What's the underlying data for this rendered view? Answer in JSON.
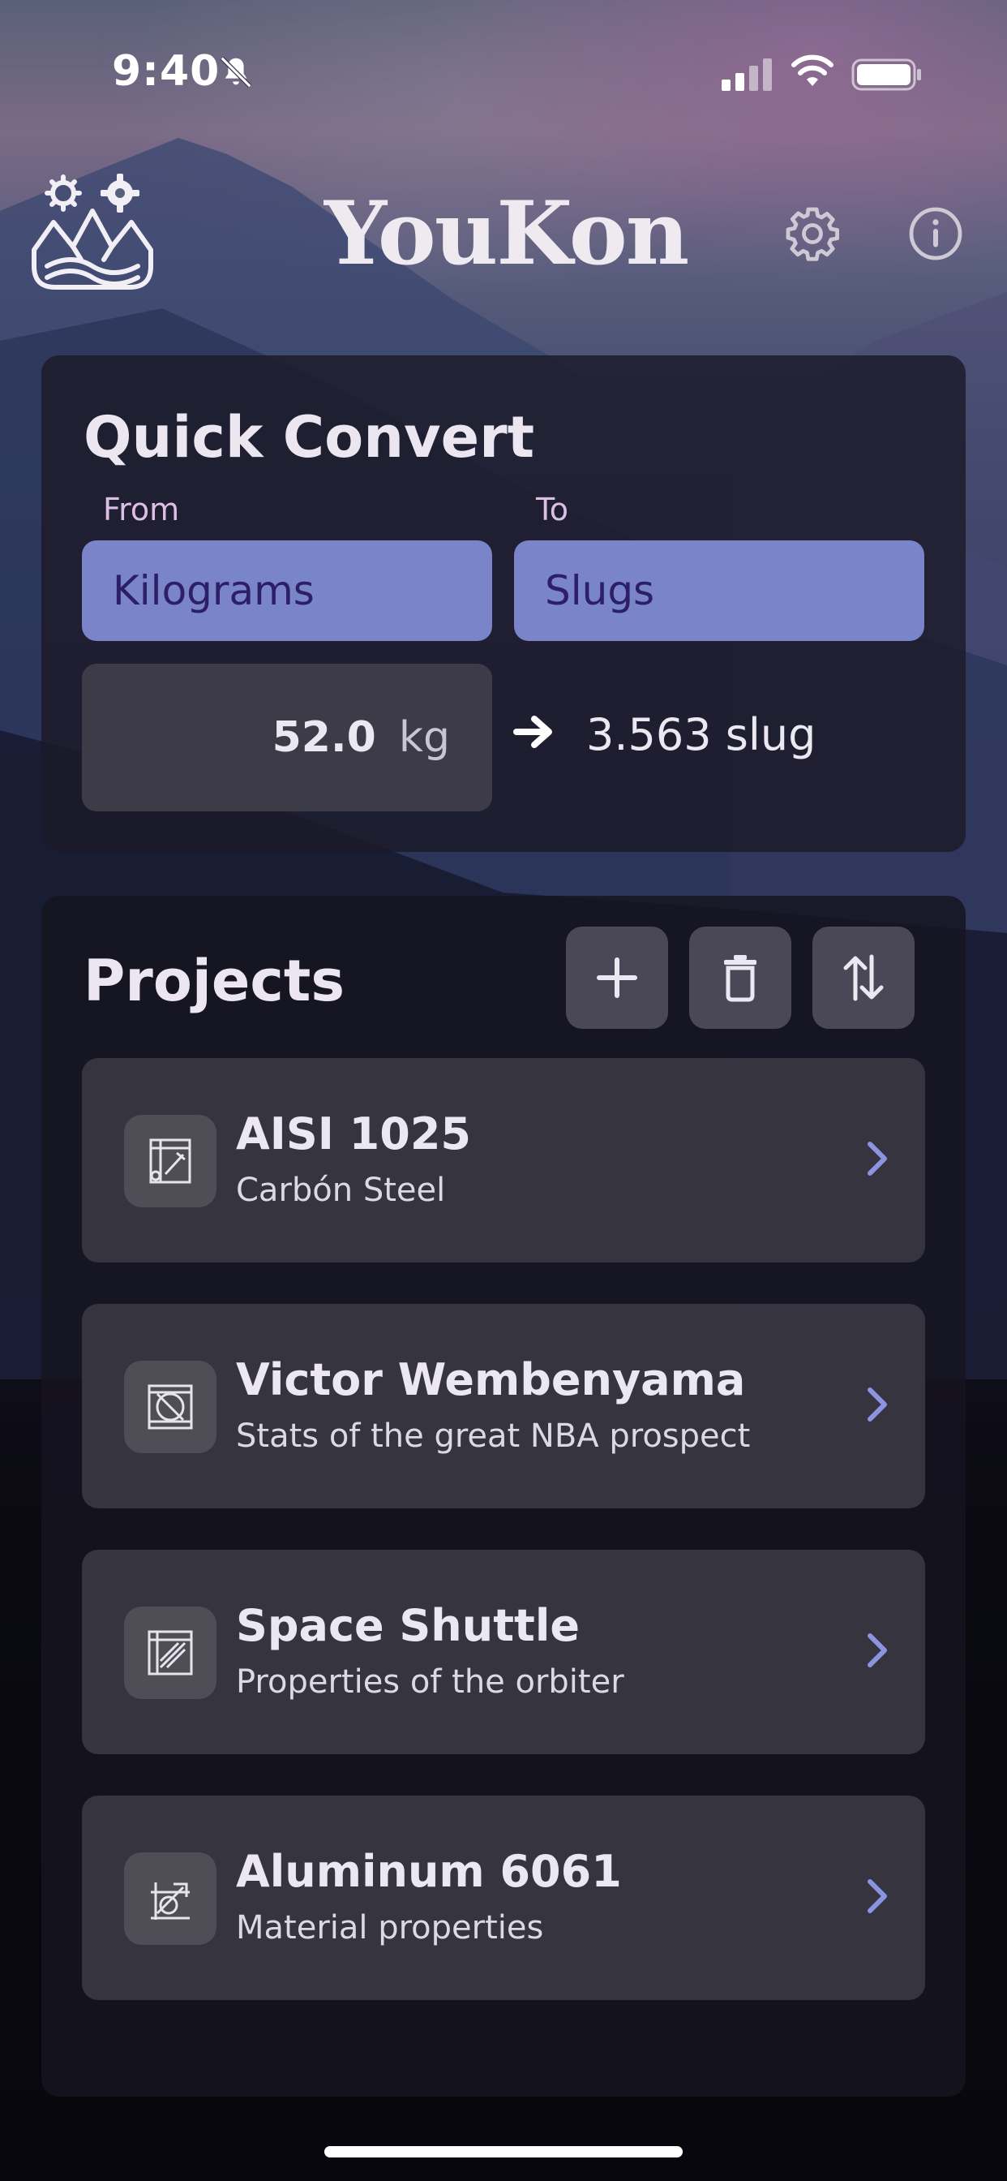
{
  "status_bar": {
    "time": "9:40",
    "icons": [
      "bell-slash-icon",
      "signal-icon",
      "wifi-icon",
      "battery-icon"
    ]
  },
  "header": {
    "title": "YouKon",
    "logo_icon": "mountain-gears-logo",
    "settings_icon": "gear-icon",
    "info_icon": "info-icon"
  },
  "quick_convert": {
    "title": "Quick Convert",
    "from_label": "From",
    "to_label": "To",
    "from_unit": "Kilograms",
    "to_unit": "Slugs",
    "input_value": "52.0",
    "input_unit": "kg",
    "result": "3.563 slug"
  },
  "projects": {
    "title": "Projects",
    "buttons": [
      "plus-icon",
      "trash-icon",
      "sort-arrows-icon"
    ],
    "items": [
      {
        "name": "AISI 1025",
        "description": "Carbón Steel"
      },
      {
        "name": "Victor Wembenyama",
        "description": "Stats of the great NBA prospect"
      },
      {
        "name": "Space Shuttle",
        "description": "Properties of the orbiter"
      },
      {
        "name": "Aluminum 6061",
        "description": "Material properties"
      }
    ]
  },
  "colors": {
    "accent": "#7a84c8",
    "accent_text": "#2c1f66",
    "chevron": "#8a94e0",
    "label": "#dcbfe6"
  }
}
